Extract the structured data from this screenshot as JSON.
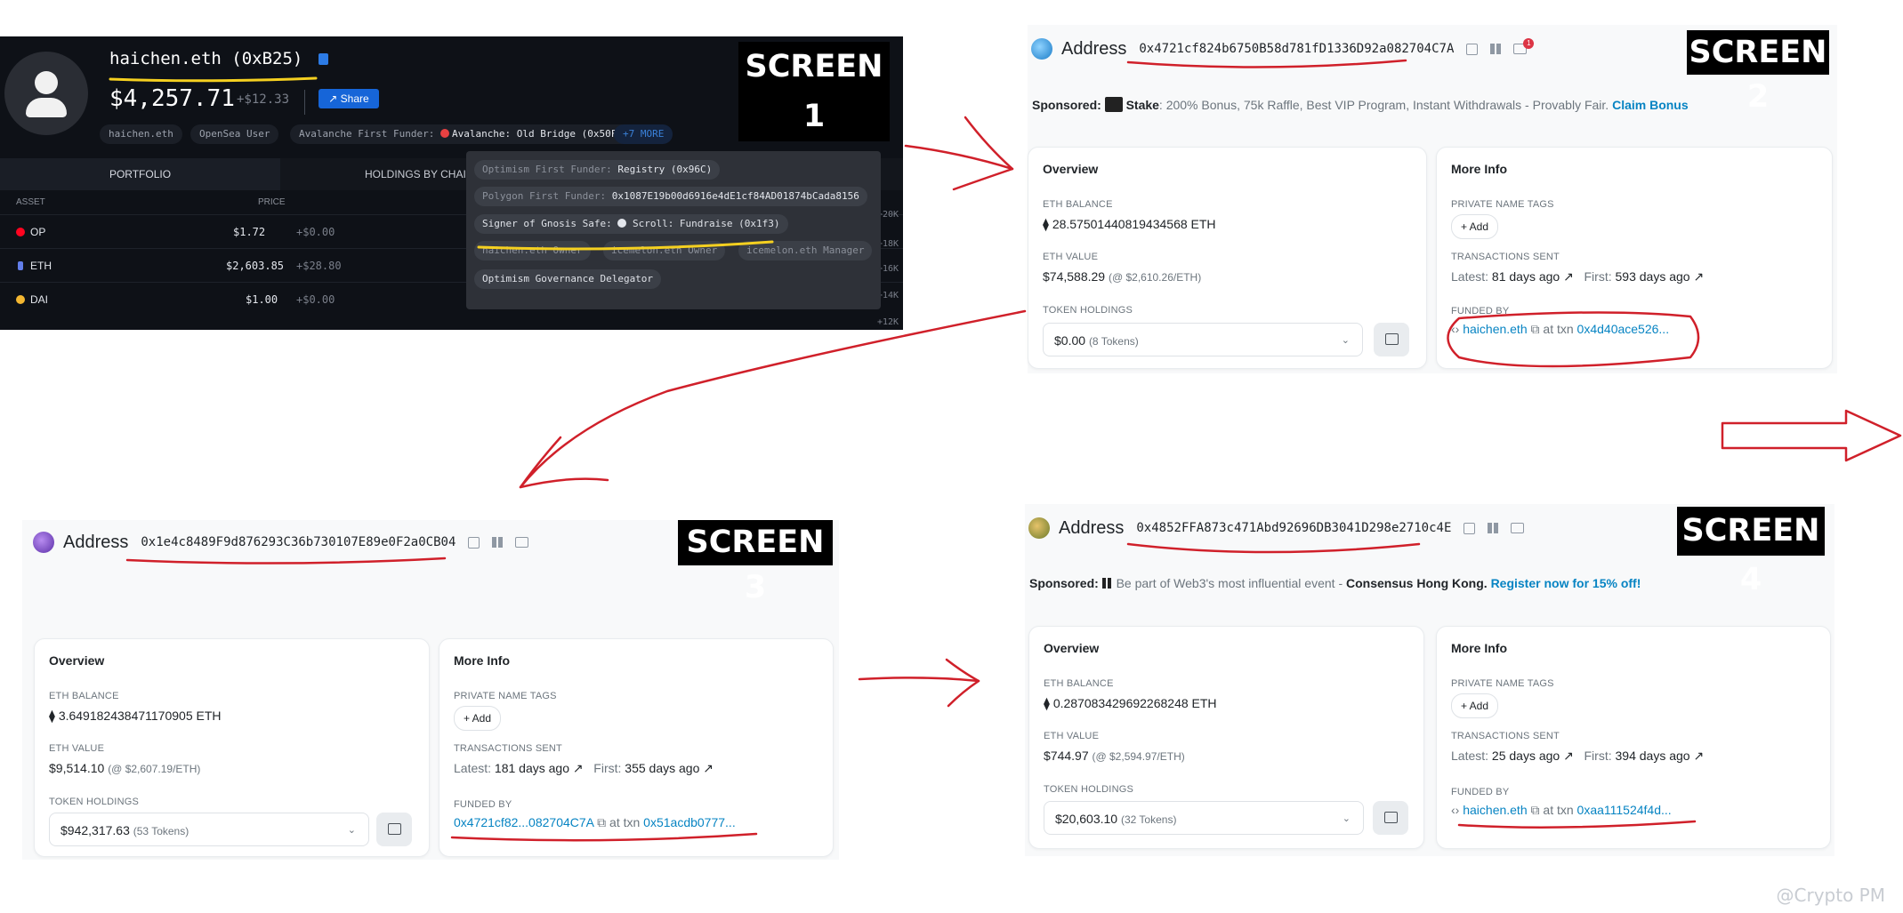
{
  "screen1": {
    "label": "SCREEN 1",
    "ens_name": "haichen.eth  (0xB25)",
    "balance": "$4,257.71",
    "change": "+$12.33",
    "share_label": "Share",
    "tags": {
      "t1": "haichen.eth",
      "t2": "OpenSea User",
      "t3_prefix": "Avalanche First Funder:",
      "t3_value": "Avalanche: Old Bridge (0x50F)",
      "more": "+7 MORE"
    },
    "popup": {
      "p1_prefix": "Optimism First Funder:",
      "p1_value": "Registry (0x96C)",
      "p2_prefix": "Polygon First Funder:",
      "p2_value": "0x1087E19b00d6916e4dE1cf84AD01874bCada8156",
      "p3_prefix": "Signer of Gnosis Safe:",
      "p3_value": "Scroll: Fundraise (0x1f3)",
      "p4": "haichen.eth Owner",
      "p5": "icemelon.eth Owner",
      "p6": "icemelon.eth Manager",
      "p7": "Optimism Governance Delegator"
    },
    "tabs": {
      "portfolio": "PORTFOLIO",
      "holdings": "HOLDINGS BY CHAI"
    },
    "columns": {
      "asset": "ASSET",
      "price": "PRICE"
    },
    "rows": [
      {
        "asset": "OP",
        "price": "$1.72",
        "delta": "+$0.00",
        "color": "#ff0420"
      },
      {
        "asset": "ETH",
        "price": "$2,603.85",
        "delta": "+$28.80",
        "color": "#627eea"
      },
      {
        "asset": "DAI",
        "price": "$1.00",
        "delta": "+$0.00",
        "color": "#f4b731"
      }
    ],
    "side_ticks": {
      "a": "+20K",
      "b": "+18K",
      "c": "+16K",
      "d": "+14K",
      "e": "+12K"
    }
  },
  "screen2": {
    "label": "SCREEN 2",
    "title": "Address",
    "address": "0x4721cf824b6750B58d781fD1336D92a082704C7A",
    "notify_count": "1",
    "sponsored_label": "Sponsored:",
    "sponsored_brand": "Stake",
    "sponsored_text": ": 200% Bonus, 75k Raffle, Best VIP Program, Instant Withdrawals - Provably Fair.",
    "sponsored_link": "Claim Bonus",
    "overview": {
      "title": "Overview",
      "eth_balance_label": "ETH BALANCE",
      "eth_balance": "28.57501440819434568 ETH",
      "eth_value_label": "ETH VALUE",
      "eth_value": "$74,588.29",
      "eth_value_rate": "(@ $2,610.26/ETH)",
      "token_label": "TOKEN HOLDINGS",
      "token_value": "$0.00",
      "token_count": "(8 Tokens)"
    },
    "more": {
      "title": "More Info",
      "tags_label": "PRIVATE NAME TAGS",
      "add": "+ Add",
      "tx_label": "TRANSACTIONS SENT",
      "latest_label": "Latest:",
      "latest": "81 days ago ↗",
      "first_label": "First:",
      "first": "593 days ago ↗",
      "funded_label": "FUNDED BY",
      "funded_by": "haichen.eth",
      "at_txn": "at txn",
      "txn": "0x4d40ace526..."
    }
  },
  "screen3": {
    "label": "SCREEN 3",
    "title": "Address",
    "address": "0x1e4c8489F9d876293C36b730107E89e0F2a0CB04",
    "overview": {
      "title": "Overview",
      "eth_balance_label": "ETH BALANCE",
      "eth_balance": "3.649182438471170905 ETH",
      "eth_value_label": "ETH VALUE",
      "eth_value": "$9,514.10",
      "eth_value_rate": "(@ $2,607.19/ETH)",
      "token_label": "TOKEN HOLDINGS",
      "token_value": "$942,317.63",
      "token_count": "(53 Tokens)"
    },
    "more": {
      "title": "More Info",
      "tags_label": "PRIVATE NAME TAGS",
      "add": "+ Add",
      "tx_label": "TRANSACTIONS SENT",
      "latest_label": "Latest:",
      "latest": "181 days ago ↗",
      "first_label": "First:",
      "first": "355 days ago ↗",
      "funded_label": "FUNDED BY",
      "funded_by": "0x4721cf82...082704C7A",
      "at_txn": "at txn",
      "txn": "0x51acdb0777..."
    }
  },
  "screen4": {
    "label": "SCREEN 4",
    "title": "Address",
    "address": "0x4852FFA873c471Abd92696DB3041D298e2710c4E",
    "sponsored_label": "Sponsored:",
    "sponsored_text": "Be part of Web3's most influential event -",
    "sponsored_brand": "Consensus Hong Kong.",
    "sponsored_link": "Register now for 15% off!",
    "overview": {
      "title": "Overview",
      "eth_balance_label": "ETH BALANCE",
      "eth_balance": "0.287083429692268248 ETH",
      "eth_value_label": "ETH VALUE",
      "eth_value": "$744.97",
      "eth_value_rate": "(@ $2,594.97/ETH)",
      "token_label": "TOKEN HOLDINGS",
      "token_value": "$20,603.10",
      "token_count": "(32 Tokens)"
    },
    "more": {
      "title": "More Info",
      "tags_label": "PRIVATE NAME TAGS",
      "add": "+ Add",
      "tx_label": "TRANSACTIONS SENT",
      "latest_label": "Latest:",
      "latest": "25 days ago ↗",
      "first_label": "First:",
      "first": "394 days ago ↗",
      "funded_label": "FUNDED BY",
      "funded_by": "haichen.eth",
      "at_txn": "at txn",
      "txn": "0xaa111524f4d..."
    }
  },
  "watermark": "@Crypto PM",
  "colors": {
    "annotation_red": "#d0202a",
    "highlight_yellow": "#f5d020",
    "link_blue": "#0784c3"
  }
}
